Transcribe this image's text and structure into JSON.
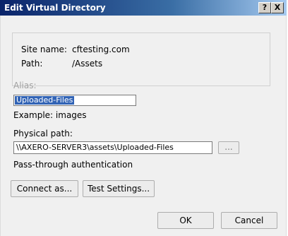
{
  "window": {
    "title": "Edit Virtual Directory",
    "help_label": "?",
    "close_label": "X"
  },
  "site_info": {
    "site_name_label": "Site name:",
    "site_name_value": "cftesting.com",
    "path_label": "Path:",
    "path_value": "/Assets"
  },
  "alias": {
    "label": "Alias:",
    "value": "Uploaded-Files",
    "example": "Example: images"
  },
  "physical_path": {
    "label": "Physical path:",
    "value": "\\\\AXERO-SERVER3\\assets\\Uploaded-Files",
    "browse_label": "..."
  },
  "pass_through_label": "Pass-through authentication",
  "buttons": {
    "connect_as": "Connect as...",
    "test_settings": "Test Settings...",
    "ok": "OK",
    "cancel": "Cancel"
  }
}
